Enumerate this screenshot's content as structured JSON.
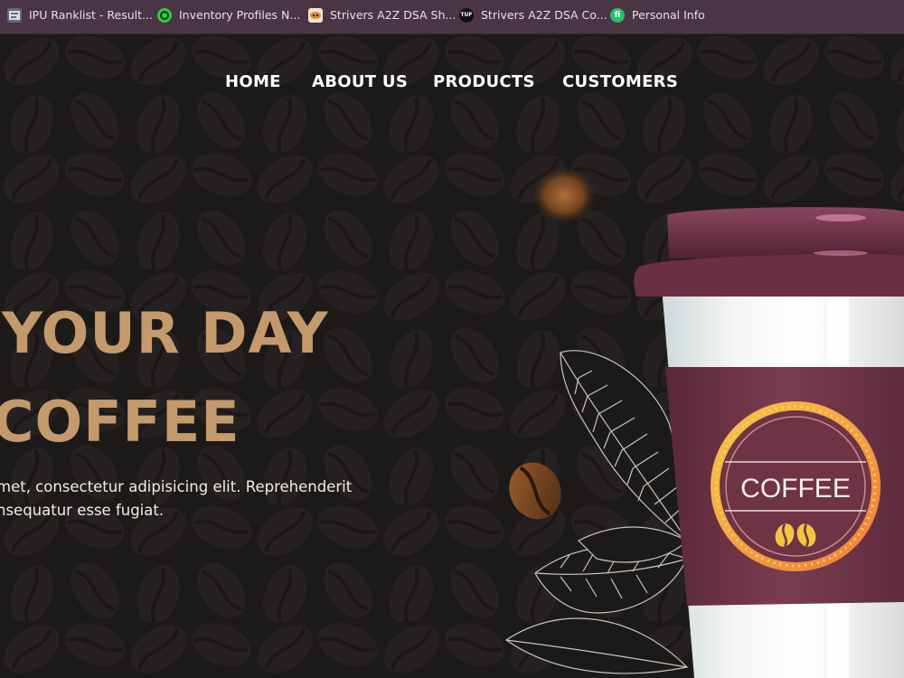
{
  "bookmarks": [
    {
      "label": "IPU Ranklist - Result...",
      "icon": "ranklist-icon",
      "color": "#6c6f78"
    },
    {
      "label": "Inventory Profiles N...",
      "icon": "inventory-profiles-icon",
      "color": "#2ecc40"
    },
    {
      "label": "Strivers A2Z DSA Sh...",
      "icon": "striver-sheet-icon",
      "color": "#e8a04a"
    },
    {
      "label": "Strivers A2Z DSA Co...",
      "icon": "tuf-icon",
      "color": "#111111"
    },
    {
      "label": "Personal Info",
      "icon": "personal-info-icon",
      "color": "#2ecc71"
    }
  ],
  "nav": {
    "home": "HOME",
    "about": "ABOUT US",
    "products": "PRODUCTS",
    "customers": "CUSTOMERS"
  },
  "hero": {
    "headline_line1": "YOUR DAY",
    "headline_line2": "COFFEE",
    "paragraph_line1": "met, consectetur adipisicing elit. Reprehenderit",
    "paragraph_line2": "nsequatur esse fugiat."
  },
  "cup": {
    "label": "COFFEE"
  },
  "colors": {
    "bookmarks_bar": "#4a3545",
    "page_bg": "#1c1a19",
    "accent_gold": "#c49a6c",
    "cup_maroon": "#6e3344"
  }
}
